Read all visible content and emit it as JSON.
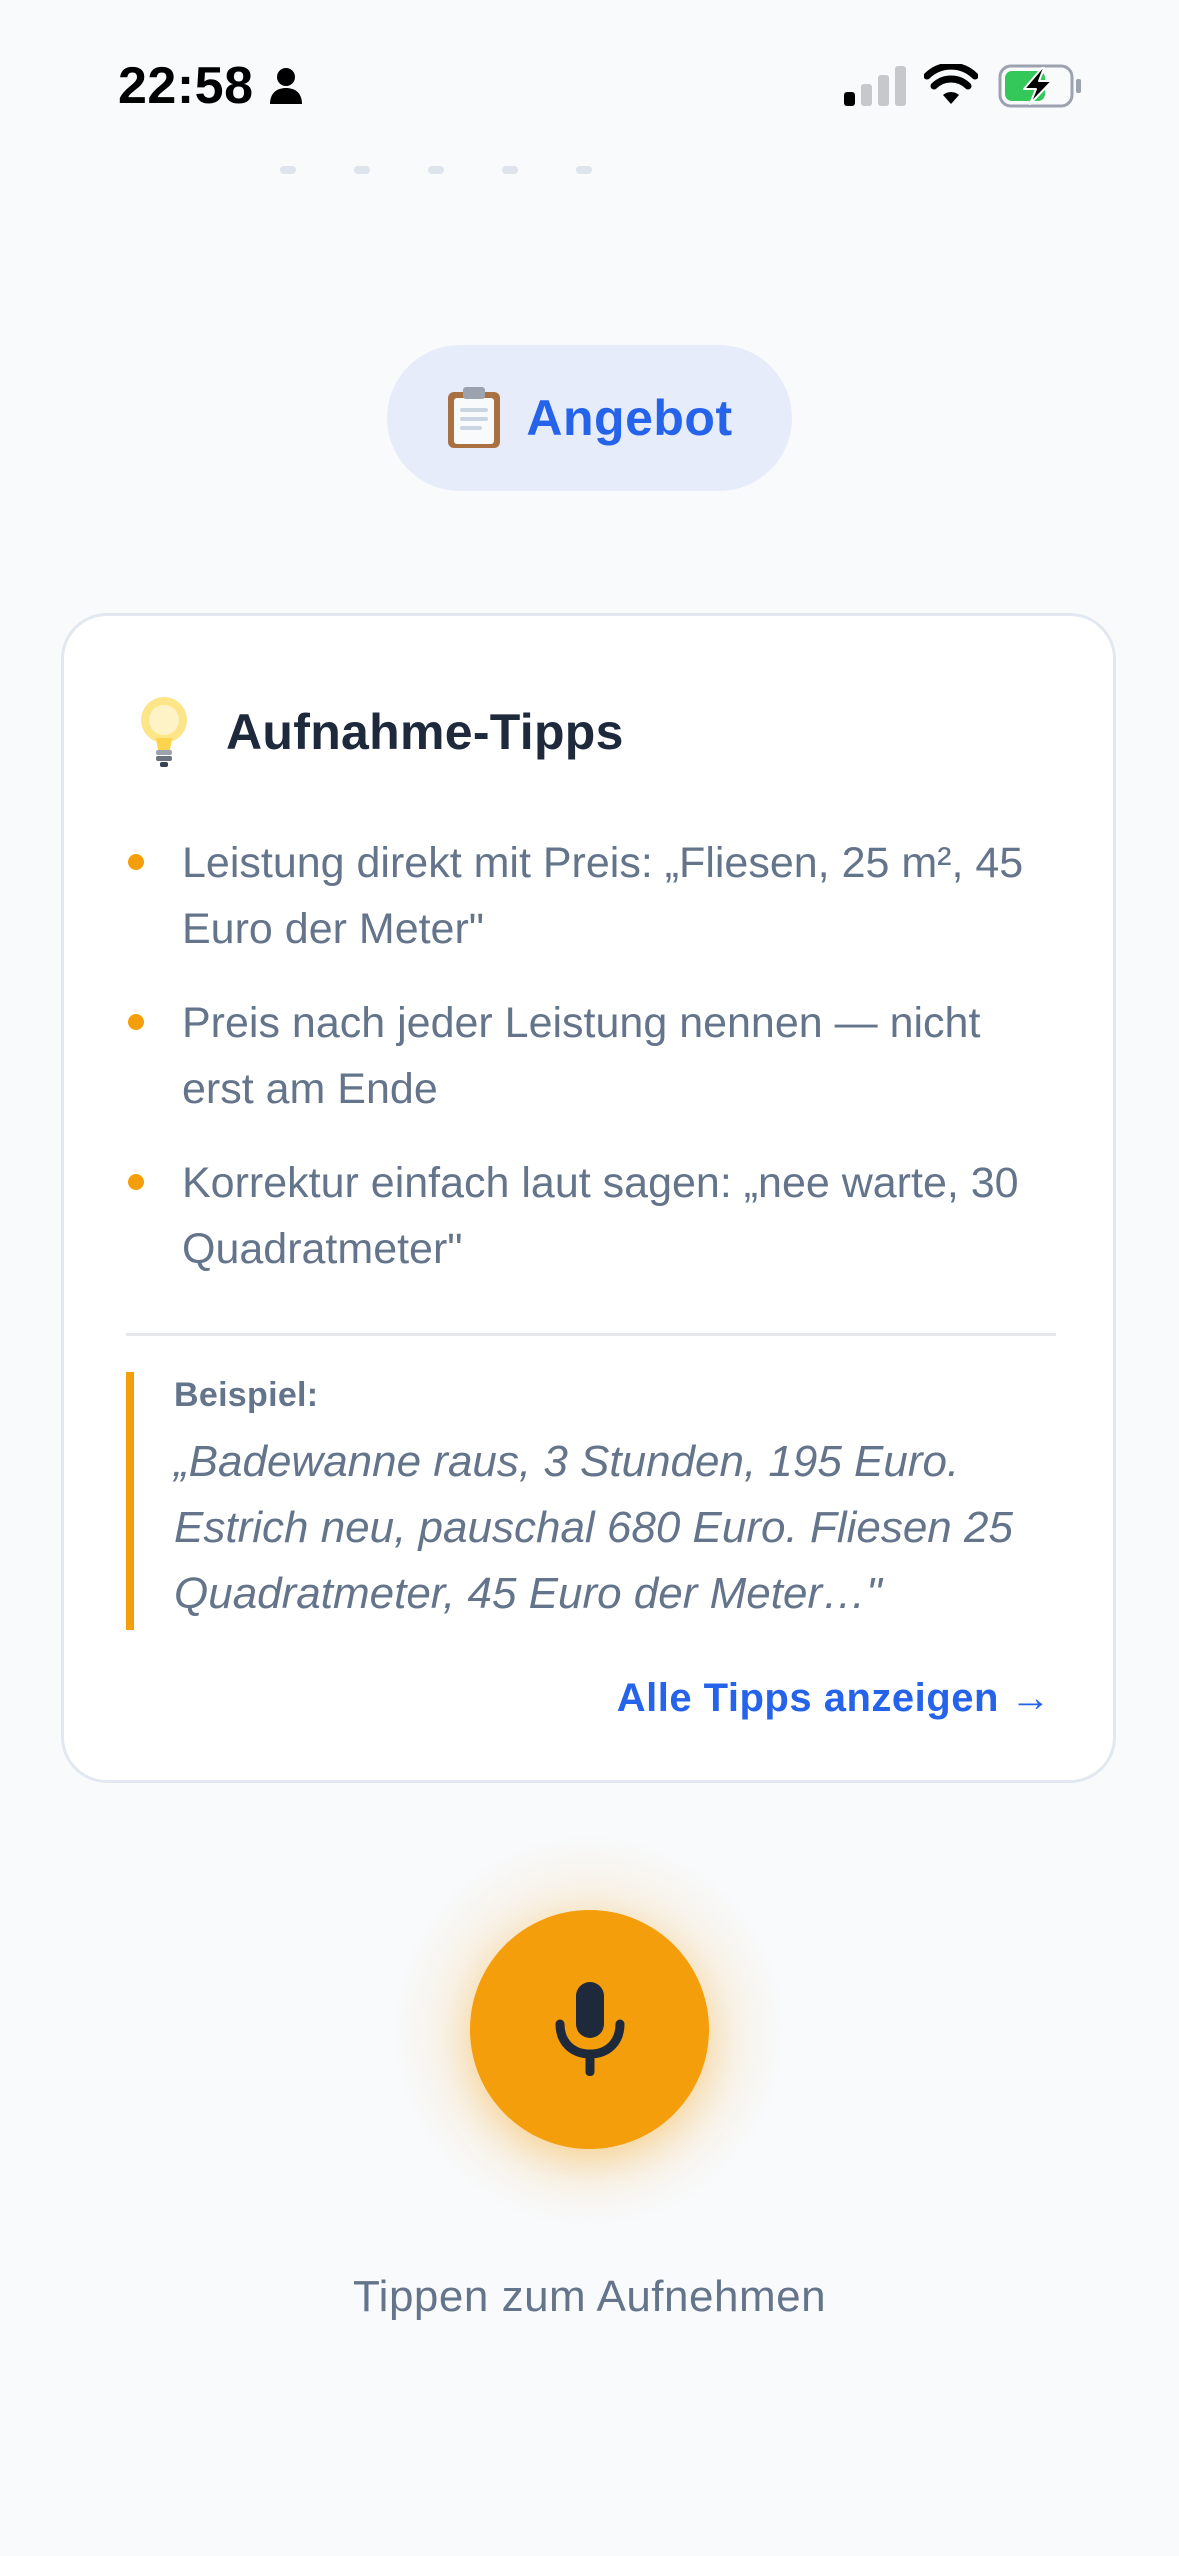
{
  "status_bar": {
    "time": "22:58",
    "icons": [
      "person-icon",
      "cellular-signal-icon",
      "wifi-icon",
      "battery-charging-icon"
    ]
  },
  "mode_chip": {
    "icon": "clipboard-icon",
    "label": "Angebot"
  },
  "tips_card": {
    "icon": "lightbulb-icon",
    "title": "Aufnahme-Tipps",
    "tips": [
      "Leistung direkt mit Preis: „Fliesen, 25 m², 45 Euro der Meter\"",
      "Preis nach jeder Leistung nennen — nicht erst am Ende",
      "Korrektur einfach laut sagen: „nee warte, 30 Quadratmeter\""
    ],
    "example_label": "Beispiel:",
    "example_text": "„Badewanne raus, 3 Stunden, 195 Euro. Estrich neu, pauschal 680 Euro. Fliesen 25 Quadratmeter, 45 Euro der Meter…\"",
    "all_tips_link": "Alle Tipps anzeigen →"
  },
  "record": {
    "icon": "microphone-icon",
    "hint": "Tippen zum Aufnehmen"
  },
  "colors": {
    "background": "#f8fafc",
    "accent_orange": "#f59e0b",
    "accent_blue": "#2563eb",
    "chip_background": "#e6ecfa",
    "muted_text": "#64748b",
    "battery_green": "#34c759"
  }
}
